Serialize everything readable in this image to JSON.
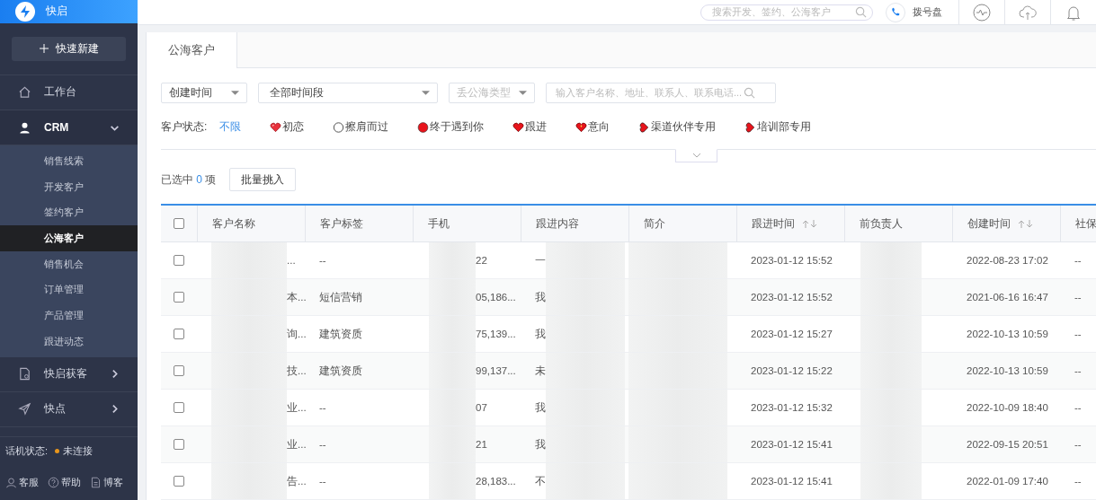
{
  "app": {
    "name": "快启"
  },
  "sidebar": {
    "create_button": "快速新建",
    "items": [
      {
        "label": "工作台",
        "expanded": false
      },
      {
        "label": "CRM",
        "expanded": true,
        "children": [
          {
            "label": "销售线索",
            "selected": false
          },
          {
            "label": "开发客户",
            "selected": false
          },
          {
            "label": "签约客户",
            "selected": false
          },
          {
            "label": "公海客户",
            "selected": true
          },
          {
            "label": "销售机会",
            "selected": false
          },
          {
            "label": "订单管理",
            "selected": false
          },
          {
            "label": "产品管理",
            "selected": false
          },
          {
            "label": "跟进动态",
            "selected": false
          }
        ]
      },
      {
        "label": "快启获客",
        "expanded": false
      },
      {
        "label": "快点",
        "expanded": false
      }
    ],
    "phone_status": {
      "label": "话机状态:",
      "value": "未连接"
    },
    "footer_links": [
      {
        "label": "客服"
      },
      {
        "label": "帮助"
      },
      {
        "label": "博客"
      }
    ]
  },
  "topbar": {
    "search": {
      "placeholder": "搜索开发、签约、公海客户"
    },
    "dialpad": "拨号盘"
  },
  "tabs": [
    {
      "label": "公海客户",
      "selected": true
    }
  ],
  "filters": {
    "time_field": "创建时间",
    "time_range": "全部时间段",
    "type": {
      "placeholder": "丢公海类型"
    },
    "search": {
      "placeholder": "输入客户名称、地址、联系人、联系电话..."
    }
  },
  "status_filter": {
    "label": "客户状态:",
    "options": [
      {
        "label": "不限",
        "kind": "none",
        "selected": true
      },
      {
        "label": "初恋",
        "kind": "heart-pink",
        "selected": false
      },
      {
        "label": "擦肩而过",
        "kind": "circle",
        "selected": false
      },
      {
        "label": "终于遇到你",
        "kind": "dot",
        "selected": false
      },
      {
        "label": "跟进",
        "kind": "heart",
        "selected": false
      },
      {
        "label": "意向",
        "kind": "heart-sparkle",
        "selected": false
      },
      {
        "label": "渠道伙伴专用",
        "kind": "heart-side",
        "selected": false
      },
      {
        "label": "培训部专用",
        "kind": "heart-side",
        "selected": false
      }
    ]
  },
  "selection": {
    "prefix": "已选中",
    "count": "0",
    "suffix": "项",
    "batch_button": "批量挑入"
  },
  "table": {
    "all_checked": false,
    "columns": [
      {
        "label": "客户名称",
        "sortable": false
      },
      {
        "label": "客户标签",
        "sortable": false
      },
      {
        "label": "手机",
        "sortable": false
      },
      {
        "label": "跟进内容",
        "sortable": false
      },
      {
        "label": "简介",
        "sortable": false
      },
      {
        "label": "跟进时间",
        "sortable": true
      },
      {
        "label": "前负责人",
        "sortable": false
      },
      {
        "label": "创建时间",
        "sortable": true
      },
      {
        "label": "社保"
      }
    ],
    "rows": [
      {
        "checked": false,
        "name": "...",
        "tag": "--",
        "phone": "22",
        "follow": "一",
        "follow_time": "2023-01-12 15:52",
        "created": "2022-08-23 17:02",
        "column_9": "--"
      },
      {
        "checked": false,
        "name": "本...",
        "tag": "短信营销",
        "phone": "05,186...",
        "follow": "我",
        "follow_time": "2023-01-12 15:52",
        "created": "2021-06-16 16:47",
        "column_9": "--"
      },
      {
        "checked": false,
        "name": "询...",
        "tag": "建筑资质",
        "phone": "75,139...",
        "follow": "我",
        "follow_time": "2023-01-12 15:27",
        "created": "2022-10-13 10:59",
        "column_9": "--"
      },
      {
        "checked": false,
        "name": "技...",
        "tag": "建筑资质",
        "phone": "99,137...",
        "follow": "未",
        "follow_time": "2023-01-12 15:22",
        "created": "2022-10-13 10:59",
        "column_9": "--"
      },
      {
        "checked": false,
        "name": "业...",
        "tag": "--",
        "phone": "07",
        "follow": "我",
        "follow_time": "2023-01-12 15:32",
        "created": "2022-10-09 18:40",
        "column_9": "--"
      },
      {
        "checked": false,
        "name": "业...",
        "tag": "--",
        "phone": "21",
        "follow": "我",
        "follow_time": "2023-01-12 15:41",
        "created": "2022-09-15 20:51",
        "column_9": "--"
      },
      {
        "checked": false,
        "name": "告...",
        "tag": "--",
        "phone": "28,183...",
        "follow": "不",
        "follow_time": "2023-01-12 15:41",
        "created": "2022-01-09 17:40",
        "column_9": "--"
      }
    ]
  }
}
